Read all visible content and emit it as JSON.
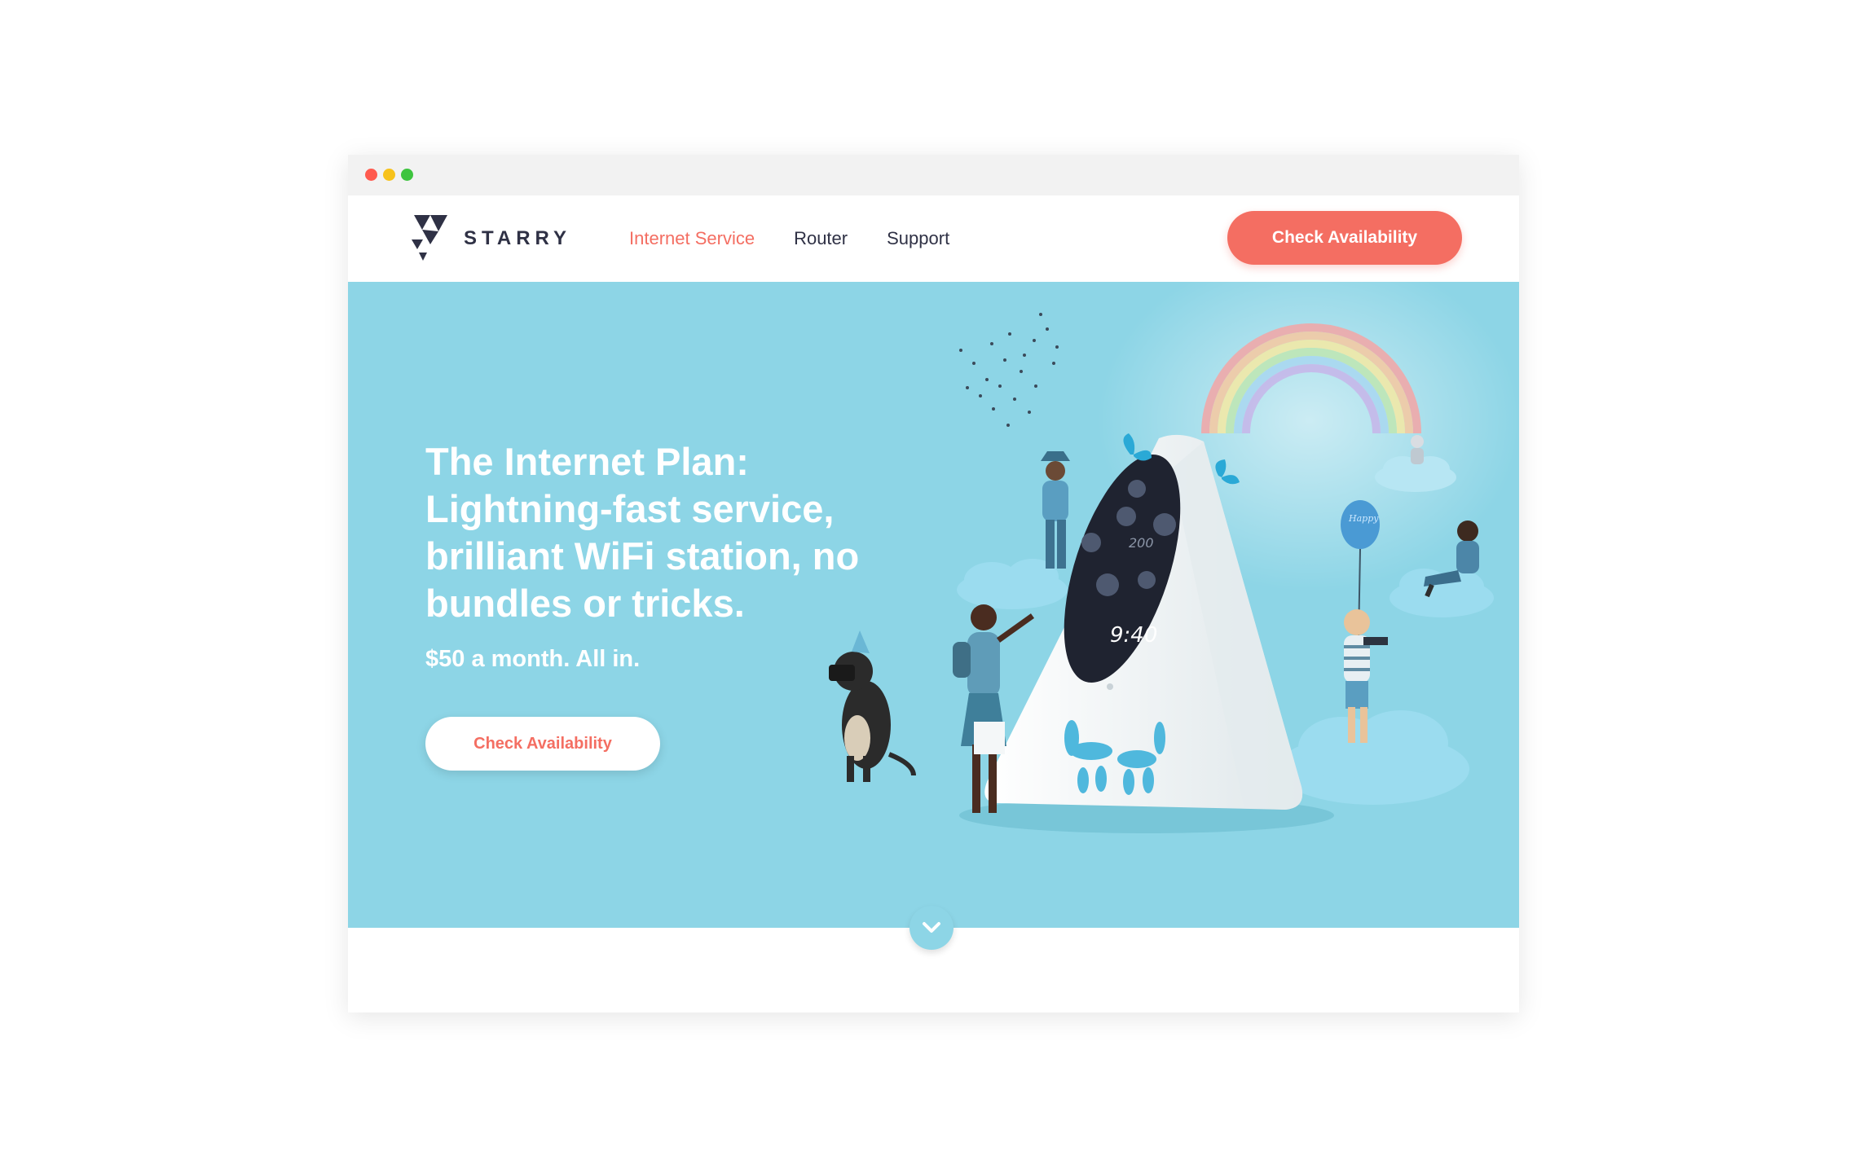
{
  "window": {
    "controls": [
      "close",
      "minimize",
      "maximize"
    ]
  },
  "brand": {
    "name": "STARRY",
    "logo_icon": "starry-logo-icon"
  },
  "nav": {
    "items": [
      {
        "label": "Internet Service",
        "active": true
      },
      {
        "label": "Router",
        "active": false
      },
      {
        "label": "Support",
        "active": false
      }
    ],
    "cta_label": "Check Availability"
  },
  "hero": {
    "title": "The Internet Plan: Lightning-fast service, brilliant WiFi station, no bundles or tricks.",
    "subtitle": "$50 a month. All in.",
    "cta_label": "Check Availability",
    "device": {
      "screen_time": "9:40",
      "screen_value": "200"
    },
    "balloon_text": "Happy"
  },
  "scroll": {
    "icon": "chevron-down-icon"
  },
  "colors": {
    "accent": "#f46e62",
    "hero_bg": "#8dd5e6",
    "text_dark": "#2f3145",
    "white": "#ffffff"
  }
}
